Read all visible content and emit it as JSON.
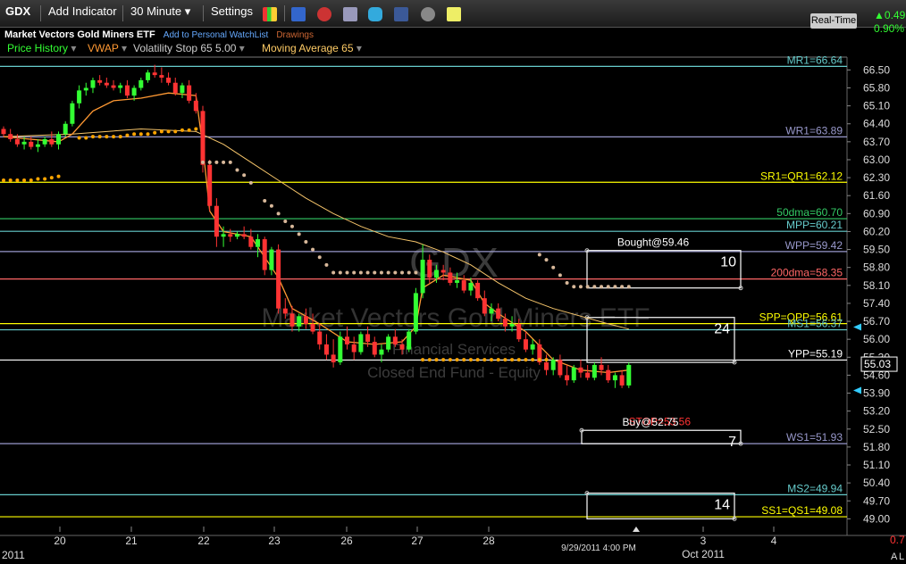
{
  "toolbar": {
    "symbol": "GDX",
    "add_indicator": "Add Indicator",
    "interval": "30 Minute",
    "settings": "Settings",
    "realtime": "Real-Time",
    "change": "0.49",
    "change_pct": "0.90%"
  },
  "header": {
    "name": "Market Vectors Gold Miners ETF",
    "watchlist": "Add to Personal WatchList",
    "drawings": "Drawings"
  },
  "indicators": [
    {
      "label": "Price History",
      "color": "#33ff33"
    },
    {
      "label": "VWAP",
      "color": "#ff9933"
    },
    {
      "label": "Volatility Stop 65 5.00",
      "color": "#cccccc"
    },
    {
      "label": "Moving Average 65",
      "color": "#ffcc66"
    }
  ],
  "watermark": {
    "symbol": "GDX",
    "name": "Market Vectors Gold Miners ETF",
    "sector": "Financial Services",
    "type": "Closed End Fund - Equity"
  },
  "chart_data": {
    "type": "candlestick",
    "ylim": [
      48.7,
      67.0
    ],
    "y_ticks": [
      "66.50",
      "65.80",
      "65.10",
      "64.40",
      "63.70",
      "63.00",
      "62.30",
      "61.60",
      "60.90",
      "60.20",
      "59.50",
      "58.80",
      "58.10",
      "57.40",
      "56.70",
      "56.00",
      "55.30",
      "54.60",
      "53.90",
      "53.20",
      "52.50",
      "51.80",
      "51.10",
      "50.40",
      "49.70",
      "49.00"
    ],
    "x_ticks": [
      "20",
      "21",
      "22",
      "23",
      "26",
      "27",
      "28",
      "3",
      "4"
    ],
    "x_edge_left": "2011",
    "x_bottom_month": "Oct 2011",
    "x_marker": "9/29/2011 4:00 PM",
    "last_price": "55.03",
    "corner_labels": [
      "0.7",
      "A",
      "L"
    ],
    "levels": [
      {
        "label": "MR1=66.64",
        "value": 66.64,
        "color": "#66cccc"
      },
      {
        "label": "WR1=63.89",
        "value": 63.89,
        "color": "#9999cc"
      },
      {
        "label": "SR1=QR1=62.12",
        "value": 62.12,
        "color": "#ffff00"
      },
      {
        "label": "50dma=60.70",
        "value": 60.7,
        "color": "#33cc66"
      },
      {
        "label": "MPP=60.21",
        "value": 60.21,
        "color": "#66cccc"
      },
      {
        "label": "WPP=59.42",
        "value": 59.42,
        "color": "#9999cc"
      },
      {
        "label": "200dma=58.35",
        "value": 58.35,
        "color": "#ff6666"
      },
      {
        "label": "SPP=QPP=56.61",
        "value": 56.61,
        "color": "#ffff00"
      },
      {
        "label": "MS1=56.37",
        "value": 56.37,
        "color": "#66cccc"
      },
      {
        "label": "YPP=55.19",
        "value": 55.19,
        "color": "#ffffff"
      },
      {
        "label": "STOP=53.56",
        "value": 53.56,
        "color": "#ff3333"
      },
      {
        "label": "WS1=51.93",
        "value": 51.93,
        "color": "#9999cc"
      },
      {
        "label": "MS2=49.94",
        "value": 49.94,
        "color": "#66cccc"
      },
      {
        "label": "SS1=QS1=49.08",
        "value": 49.08,
        "color": "#ffff00"
      }
    ],
    "annotations": [
      {
        "label": "Bought@59.46",
        "number": "10",
        "top": 59.46,
        "bottom": 58.0,
        "color": "#ffffff"
      },
      {
        "label": "",
        "number": "24",
        "top": 56.85,
        "bottom": 55.1,
        "color": "#ffffff"
      },
      {
        "label": "Buy@52.75",
        "number": "7",
        "top": 52.45,
        "bottom": 51.93,
        "color": "#ffffff"
      },
      {
        "label": "",
        "number": "14",
        "top": 50.0,
        "bottom": 49.0,
        "color": "#ffffff"
      }
    ],
    "ohlc": [
      [
        64.2,
        64.3,
        63.9,
        64.0
      ],
      [
        64.0,
        64.2,
        63.7,
        63.8
      ],
      [
        63.8,
        64.0,
        63.5,
        63.6
      ],
      [
        63.6,
        63.9,
        63.4,
        63.7
      ],
      [
        63.7,
        63.9,
        63.4,
        63.5
      ],
      [
        63.5,
        63.8,
        63.3,
        63.6
      ],
      [
        63.6,
        63.9,
        63.5,
        63.8
      ],
      [
        63.8,
        64.1,
        63.5,
        63.6
      ],
      [
        63.6,
        64.1,
        63.4,
        64.0
      ],
      [
        64.0,
        64.5,
        63.9,
        64.4
      ],
      [
        64.4,
        65.3,
        64.3,
        65.2
      ],
      [
        65.2,
        65.9,
        65.0,
        65.7
      ],
      [
        65.7,
        66.0,
        65.5,
        65.8
      ],
      [
        65.8,
        66.2,
        65.6,
        66.1
      ],
      [
        66.1,
        66.3,
        65.9,
        66.0
      ],
      [
        66.0,
        66.2,
        65.8,
        65.9
      ],
      [
        65.9,
        66.1,
        65.7,
        65.8
      ],
      [
        65.8,
        66.0,
        65.6,
        65.9
      ],
      [
        65.9,
        66.1,
        65.4,
        65.5
      ],
      [
        65.5,
        65.9,
        65.3,
        65.8
      ],
      [
        65.8,
        66.2,
        65.7,
        66.1
      ],
      [
        66.1,
        66.5,
        66.0,
        66.4
      ],
      [
        66.4,
        66.7,
        66.2,
        66.3
      ],
      [
        66.3,
        66.6,
        66.0,
        66.2
      ],
      [
        66.2,
        66.4,
        65.9,
        66.0
      ],
      [
        66.0,
        66.2,
        65.5,
        65.6
      ],
      [
        65.6,
        66.0,
        65.4,
        65.9
      ],
      [
        65.9,
        66.1,
        65.2,
        65.3
      ],
      [
        65.3,
        65.6,
        64.8,
        64.9
      ],
      [
        64.9,
        65.1,
        62.5,
        62.8
      ],
      [
        62.8,
        63.0,
        61.0,
        61.2
      ],
      [
        61.2,
        61.5,
        59.6,
        60.0
      ],
      [
        60.0,
        60.4,
        59.6,
        60.1
      ],
      [
        60.1,
        60.3,
        59.8,
        60.0
      ],
      [
        60.0,
        60.2,
        59.9,
        60.1
      ],
      [
        60.1,
        60.4,
        59.9,
        60.0
      ],
      [
        60.0,
        60.3,
        59.5,
        59.6
      ],
      [
        59.6,
        60.1,
        59.2,
        59.9
      ],
      [
        59.9,
        60.0,
        58.5,
        58.7
      ],
      [
        58.7,
        59.6,
        58.5,
        59.5
      ],
      [
        59.5,
        59.7,
        57.0,
        57.2
      ],
      [
        57.2,
        57.6,
        56.8,
        57.0
      ],
      [
        57.0,
        57.3,
        56.3,
        56.5
      ],
      [
        56.5,
        57.0,
        56.3,
        56.9
      ],
      [
        56.9,
        57.2,
        56.4,
        56.6
      ],
      [
        56.6,
        57.0,
        56.2,
        56.3
      ],
      [
        56.3,
        56.6,
        55.6,
        55.8
      ],
      [
        55.8,
        56.2,
        55.2,
        55.4
      ],
      [
        55.4,
        56.0,
        54.9,
        55.1
      ],
      [
        55.1,
        56.3,
        55.0,
        56.1
      ],
      [
        56.1,
        56.5,
        55.6,
        55.8
      ],
      [
        55.8,
        56.1,
        55.2,
        55.5
      ],
      [
        55.5,
        56.3,
        55.4,
        56.2
      ],
      [
        56.2,
        56.5,
        55.7,
        55.9
      ],
      [
        55.9,
        56.1,
        55.3,
        55.4
      ],
      [
        55.4,
        55.8,
        55.1,
        55.6
      ],
      [
        55.6,
        56.2,
        55.5,
        56.1
      ],
      [
        56.1,
        56.4,
        55.7,
        55.8
      ],
      [
        55.8,
        56.0,
        55.4,
        55.6
      ],
      [
        55.6,
        56.4,
        55.5,
        56.3
      ],
      [
        56.3,
        58.0,
        56.2,
        57.8
      ],
      [
        57.8,
        59.7,
        57.6,
        59.1
      ],
      [
        59.1,
        59.3,
        58.2,
        58.4
      ],
      [
        58.4,
        58.9,
        58.2,
        58.7
      ],
      [
        58.7,
        58.9,
        58.3,
        58.6
      ],
      [
        58.6,
        58.8,
        58.1,
        58.2
      ],
      [
        58.2,
        58.6,
        58.0,
        58.3
      ],
      [
        58.3,
        58.5,
        57.8,
        57.9
      ],
      [
        57.9,
        58.4,
        57.7,
        58.2
      ],
      [
        58.2,
        58.3,
        57.5,
        57.6
      ],
      [
        57.6,
        57.9,
        56.9,
        57.0
      ],
      [
        57.0,
        57.4,
        56.7,
        57.2
      ],
      [
        57.2,
        57.4,
        56.7,
        56.8
      ],
      [
        56.8,
        57.0,
        56.3,
        56.5
      ],
      [
        56.5,
        56.9,
        56.3,
        56.6
      ],
      [
        56.6,
        56.8,
        55.9,
        56.0
      ],
      [
        56.0,
        56.3,
        55.5,
        55.6
      ],
      [
        55.6,
        56.0,
        55.4,
        55.8
      ],
      [
        55.8,
        56.0,
        55.0,
        55.1
      ],
      [
        55.1,
        55.4,
        54.6,
        54.8
      ],
      [
        54.8,
        55.3,
        54.6,
        55.2
      ],
      [
        55.2,
        55.4,
        54.5,
        54.6
      ],
      [
        54.6,
        55.0,
        54.2,
        54.4
      ],
      [
        54.4,
        55.0,
        54.3,
        54.9
      ],
      [
        54.9,
        55.2,
        54.5,
        54.7
      ],
      [
        54.7,
        55.0,
        54.4,
        54.5
      ],
      [
        54.5,
        55.1,
        54.4,
        55.0
      ],
      [
        55.0,
        55.3,
        54.6,
        54.8
      ],
      [
        54.8,
        55.0,
        54.3,
        54.4
      ],
      [
        54.4,
        54.7,
        54.1,
        54.6
      ],
      [
        54.6,
        54.8,
        54.1,
        54.2
      ],
      [
        54.2,
        55.1,
        54.1,
        55.0
      ]
    ],
    "vwap": [
      [
        0,
        63.9
      ],
      [
        8,
        63.7
      ],
      [
        10,
        64.0
      ],
      [
        13,
        64.9
      ],
      [
        16,
        65.3
      ],
      [
        20,
        65.4
      ],
      [
        24,
        65.6
      ],
      [
        28,
        65.5
      ],
      [
        29,
        63.5
      ],
      [
        30,
        61.0
      ],
      [
        32,
        60.2
      ],
      [
        36,
        60.0
      ],
      [
        40,
        58.4
      ],
      [
        42,
        57.2
      ],
      [
        46,
        56.6
      ],
      [
        50,
        55.9
      ],
      [
        54,
        55.8
      ],
      [
        58,
        55.9
      ],
      [
        60,
        56.5
      ],
      [
        61,
        58.0
      ],
      [
        64,
        58.5
      ],
      [
        68,
        58.3
      ],
      [
        70,
        57.4
      ],
      [
        72,
        57.0
      ],
      [
        76,
        56.3
      ],
      [
        80,
        55.2
      ],
      [
        84,
        54.8
      ],
      [
        88,
        54.7
      ],
      [
        91,
        54.8
      ]
    ],
    "ma65": [
      [
        0,
        63.9
      ],
      [
        10,
        64.0
      ],
      [
        20,
        64.2
      ],
      [
        28,
        64.1
      ],
      [
        32,
        63.6
      ],
      [
        36,
        62.9
      ],
      [
        40,
        62.2
      ],
      [
        44,
        61.5
      ],
      [
        48,
        60.9
      ],
      [
        52,
        60.4
      ],
      [
        56,
        60.0
      ],
      [
        60,
        59.8
      ],
      [
        64,
        59.4
      ],
      [
        68,
        58.9
      ],
      [
        72,
        58.2
      ],
      [
        76,
        57.6
      ],
      [
        80,
        57.2
      ],
      [
        84,
        56.9
      ],
      [
        88,
        56.6
      ],
      [
        91,
        56.4
      ]
    ],
    "vstop": [
      [
        0,
        62.2
      ],
      [
        1,
        62.2
      ],
      [
        2,
        62.2
      ],
      [
        3,
        62.2
      ],
      [
        4,
        62.2
      ],
      [
        5,
        62.25
      ],
      [
        6,
        62.25
      ],
      [
        7,
        62.3
      ],
      [
        8,
        62.35
      ],
      [
        11,
        63.85
      ],
      [
        12,
        63.85
      ],
      [
        13,
        63.9
      ],
      [
        14,
        63.9
      ],
      [
        15,
        63.9
      ],
      [
        16,
        63.9
      ],
      [
        17,
        63.9
      ],
      [
        18,
        63.95
      ],
      [
        19,
        64.0
      ],
      [
        20,
        64.0
      ],
      [
        21,
        64.0
      ],
      [
        22,
        64.05
      ],
      [
        23,
        64.1
      ],
      [
        24,
        64.1
      ],
      [
        25,
        64.1
      ],
      [
        26,
        64.15
      ],
      [
        27,
        64.15
      ],
      [
        28,
        64.2
      ],
      [
        29,
        62.9
      ],
      [
        30,
        62.9
      ],
      [
        31,
        62.9
      ],
      [
        32,
        62.9
      ],
      [
        33,
        62.9
      ],
      [
        34,
        62.6
      ],
      [
        35,
        62.4
      ],
      [
        36,
        62.1
      ],
      [
        38,
        61.4
      ],
      [
        39,
        61.2
      ],
      [
        40,
        60.9
      ],
      [
        41,
        60.6
      ],
      [
        42,
        60.4
      ],
      [
        43,
        60.1
      ],
      [
        44,
        59.8
      ],
      [
        45,
        59.5
      ],
      [
        46,
        59.2
      ],
      [
        47,
        58.9
      ],
      [
        48,
        58.6
      ],
      [
        49,
        58.6
      ],
      [
        50,
        58.6
      ],
      [
        51,
        58.6
      ],
      [
        52,
        58.6
      ],
      [
        53,
        58.6
      ],
      [
        54,
        58.6
      ],
      [
        55,
        58.6
      ],
      [
        56,
        58.6
      ],
      [
        57,
        58.6
      ],
      [
        58,
        58.6
      ],
      [
        59,
        58.6
      ],
      [
        60,
        58.6
      ],
      [
        61,
        55.2
      ],
      [
        62,
        55.2
      ],
      [
        63,
        55.2
      ],
      [
        64,
        55.2
      ],
      [
        65,
        55.2
      ],
      [
        66,
        55.2
      ],
      [
        67,
        55.2
      ],
      [
        68,
        55.2
      ],
      [
        69,
        55.2
      ],
      [
        70,
        55.2
      ],
      [
        71,
        55.2
      ],
      [
        72,
        55.2
      ],
      [
        73,
        55.2
      ],
      [
        74,
        55.2
      ],
      [
        75,
        55.2
      ],
      [
        76,
        55.2
      ],
      [
        77,
        55.2
      ],
      [
        78,
        55.2
      ],
      [
        79,
        55.2
      ],
      [
        78,
        59.3
      ],
      [
        79,
        59.1
      ],
      [
        80,
        58.8
      ],
      [
        81,
        58.5
      ],
      [
        82,
        58.2
      ],
      [
        83,
        58.05
      ],
      [
        84,
        58.05
      ],
      [
        85,
        58.05
      ],
      [
        86,
        58.05
      ],
      [
        87,
        58.05
      ],
      [
        88,
        58.05
      ],
      [
        89,
        58.05
      ],
      [
        90,
        58.05
      ],
      [
        91,
        58.05
      ]
    ]
  }
}
